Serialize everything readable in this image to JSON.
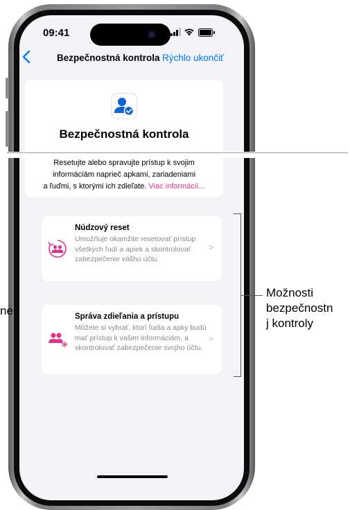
{
  "status_bar": {
    "time": "09:41"
  },
  "nav": {
    "back": "<",
    "title": "Bezpečnostná kontrola",
    "quick_exit": "Rýchlo ukončiť"
  },
  "header_card": {
    "title": "Bezpečnostná kontrola",
    "desc_line1": "Resetujte alebo spravujte prístup k svojim",
    "desc_line2": "informáciám naprieč apkami, zariadeniami",
    "desc_line3": "a ľuďmi, s ktorými ich zdieľate.",
    "link": "Viac informácií..."
  },
  "options": [
    {
      "title": "Núdzový reset",
      "desc": "Umožňuje okamžite resetovať prístup všetkých ľudí a apiek a skontrolovať zabezpečenie vášho účtu.",
      "icon": "emergency-reset-icon"
    },
    {
      "title": "Správa zdieľania a prístupu",
      "desc": "Môžete si vybrať, ktorí ľudia a apky budú mať prístup k vašim informáciám, a skontrolovať zabezpečenie svojho účtu.",
      "icon": "sharing-access-icon"
    }
  ],
  "chevron": ">",
  "callout": {
    "line1": "Možnosti",
    "line2": "bezpečnostn",
    "line3": "j kontroly"
  },
  "left_fragment": "ne",
  "colors": {
    "accent_pink": "#e0348a",
    "link_blue": "#007aff",
    "background": "#f2f2f7"
  }
}
